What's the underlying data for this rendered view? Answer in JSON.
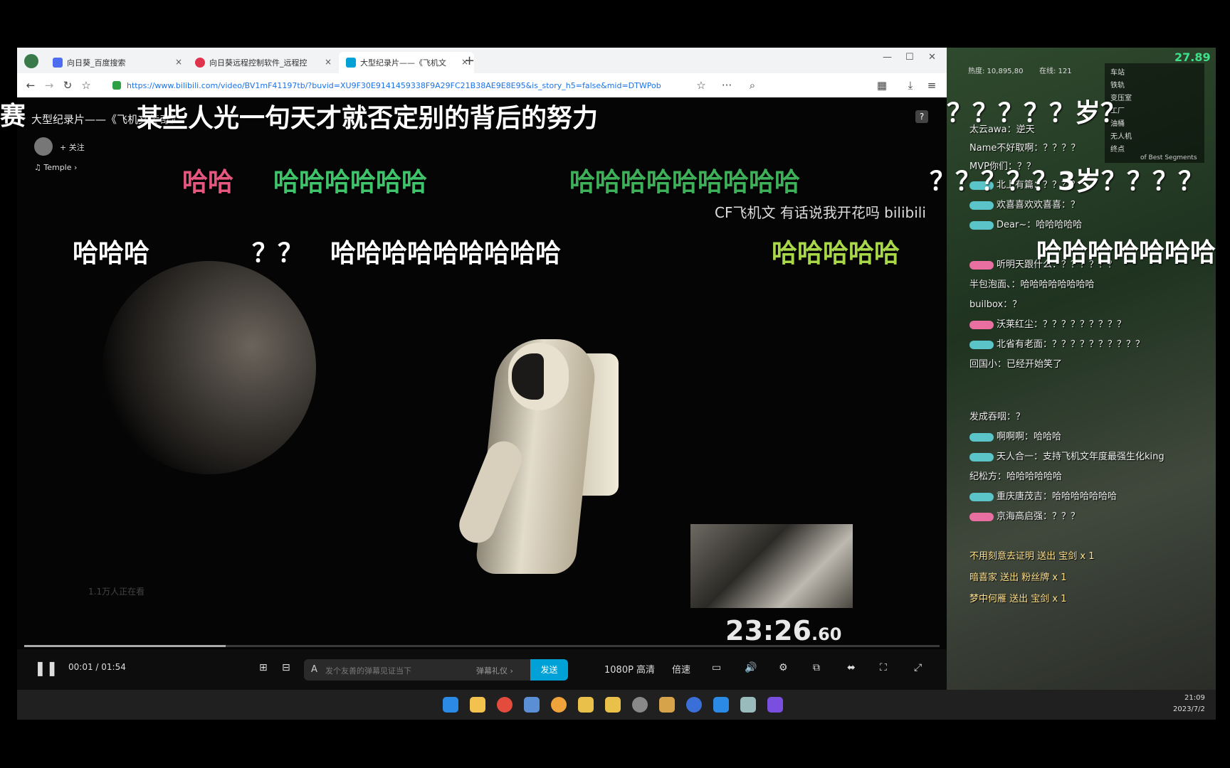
{
  "tabs": [
    {
      "label": "向日葵_百度搜索",
      "color": "#4e6ef2"
    },
    {
      "label": "向日葵远程控制软件_远程控",
      "color": "#e0334c"
    },
    {
      "label": "大型纪录片——《飞机文",
      "color": "#00a1d6"
    }
  ],
  "address_url": "https://www.bilibili.com/video/BV1mF41197tb/?buvid=XU9F30E9141459338F9A29FC21B38AE9E8E95&is_story_h5=false&mid=DTWPob",
  "video": {
    "title": "大型纪录片——《飞机文传奇》",
    "follow_label": "+ 关注",
    "music_label": "♫ Temple ›",
    "watermark": "CF飞机文 有话说我开花吗 bilibili",
    "viewers": "1.1万人正在看",
    "speedrun_timer_main": "23:26",
    "speedrun_timer_frac": ".60",
    "progress_fraction": 0.22
  },
  "danmaku": [
    {
      "text": "赛",
      "color": "#ffffff"
    },
    {
      "text": "某些人光一句天才就否定别的背后的努力",
      "color": "#ffffff"
    },
    {
      "text": "哈哈",
      "color": "#e5577e"
    },
    {
      "text": "哈哈哈哈哈哈",
      "color": "#3fc46b"
    },
    {
      "text": "哈哈哈哈哈哈哈哈哈",
      "color": "#3fb05a"
    },
    {
      "text": "？？？？？3岁？？？？",
      "color": "#ffffff"
    },
    {
      "text": "哈哈哈",
      "color": "#ffffff"
    },
    {
      "text": "？？",
      "color": "#ffffff"
    },
    {
      "text": "哈哈哈哈哈哈哈哈哈",
      "color": "#ffffff"
    },
    {
      "text": "哈哈哈哈哈",
      "color": "#a8d84a"
    },
    {
      "text": "哈哈哈哈哈哈哈",
      "color": "#ffffff"
    },
    {
      "text": "？？？？？岁？",
      "color": "#ffffff"
    }
  ],
  "controls": {
    "time": "00:01 / 01:54",
    "input_placeholder": "发个友善的弹幕见证当下",
    "etiquette": "弹幕礼仪 ›",
    "send": "发送",
    "quality": "1080P 高清",
    "speed": "倍速"
  },
  "stream": {
    "fps": "27.89",
    "stat_left": "热度: 10,895,80",
    "stat_right": "在线: 121",
    "chat": [
      "太云awa：逆天",
      "Name不好取啊：？？？？",
      "MVP你们：？？",
      "北上有篇：？？？？",
      "欢喜喜欢欢喜喜：？",
      "Dear~：哈哈哈哈哈",
      "听明天跟什么：？？？？？？",
      "半包泡面、：哈哈哈哈哈哈哈哈",
      "builbox：？",
      "沃莱红尘：？？？？？？？？？",
      "北省有老面：？？？？？？？？？？",
      "回国小：已经开始笑了",
      "发成吞咽：？",
      "啊啊啊：哈哈哈",
      "天人合一：支持飞机文年度最强生化king",
      "纪松方：哈哈哈哈哈哈",
      "重庆唐茂吉：哈哈哈哈哈哈哈",
      "京海高启强：？？？",
      "不用刻意去证明 送出 宝剑 x 1",
      "暗喜家 送出 粉丝牌 x 1",
      "梦中何雁 送出 宝剑 x 1"
    ],
    "side_list": [
      "车站",
      "铁轨",
      "变压室",
      "工厂",
      "油桶",
      "无人机",
      "终点"
    ],
    "side_footer": "of Best Segments"
  },
  "clock": {
    "time": "21:09",
    "date": "2023/7/2"
  }
}
